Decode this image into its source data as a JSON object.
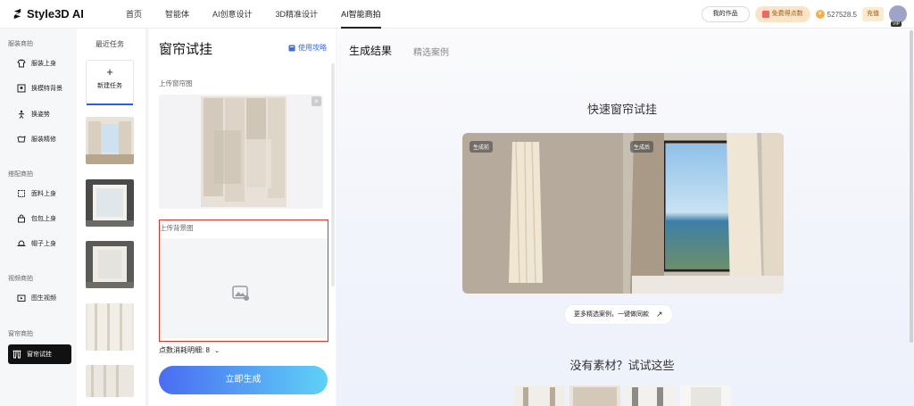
{
  "app": {
    "logo_text": "Style3D AI"
  },
  "nav": [
    {
      "label": "首页"
    },
    {
      "label": "智能体"
    },
    {
      "label": "AI创意设计"
    },
    {
      "label": "3D精准设计"
    },
    {
      "label": "AI智能商拍"
    }
  ],
  "top_right": {
    "my_works": "我的作品",
    "free_points": "免费得点数",
    "points": "527528.5",
    "recharge": "充值",
    "vip": "VIP"
  },
  "sidebar": {
    "groups": [
      {
        "label": "服装商拍",
        "items": [
          {
            "label": "服装上身"
          },
          {
            "label": "换模特背景"
          },
          {
            "label": "换姿势"
          },
          {
            "label": "服装精修"
          }
        ]
      },
      {
        "label": "搭配商拍",
        "items": [
          {
            "label": "面料上身"
          },
          {
            "label": "包包上身"
          },
          {
            "label": "帽子上身"
          }
        ]
      },
      {
        "label": "视频商拍",
        "items": [
          {
            "label": "图生视频"
          }
        ]
      },
      {
        "label": "窗帘商拍",
        "items": [
          {
            "label": "窗帘试挂"
          }
        ]
      }
    ]
  },
  "tasks": {
    "title": "最近任务",
    "new_task": "新建任务",
    "plus": "+"
  },
  "form": {
    "title": "窗帘试挂",
    "guide": "使用攻略",
    "upload_curtain": "上传窗帘图",
    "upload_background": "上传背景图",
    "cost_detail": "点数消耗明细: 8",
    "generate": "立即生成",
    "close": "×"
  },
  "main": {
    "tab_result": "生成结果",
    "tab_cases": "精选案例",
    "quick_title": "快速窗帘试挂",
    "before_label": "生成前",
    "after_label": "生成后",
    "more_cases": "更多精选案例，一键做同款",
    "no_material": "没有素材？试试这些"
  },
  "colors": {
    "accent": "#2563d9",
    "highlight_border": "#e0352b",
    "active_nav": "#111111"
  }
}
